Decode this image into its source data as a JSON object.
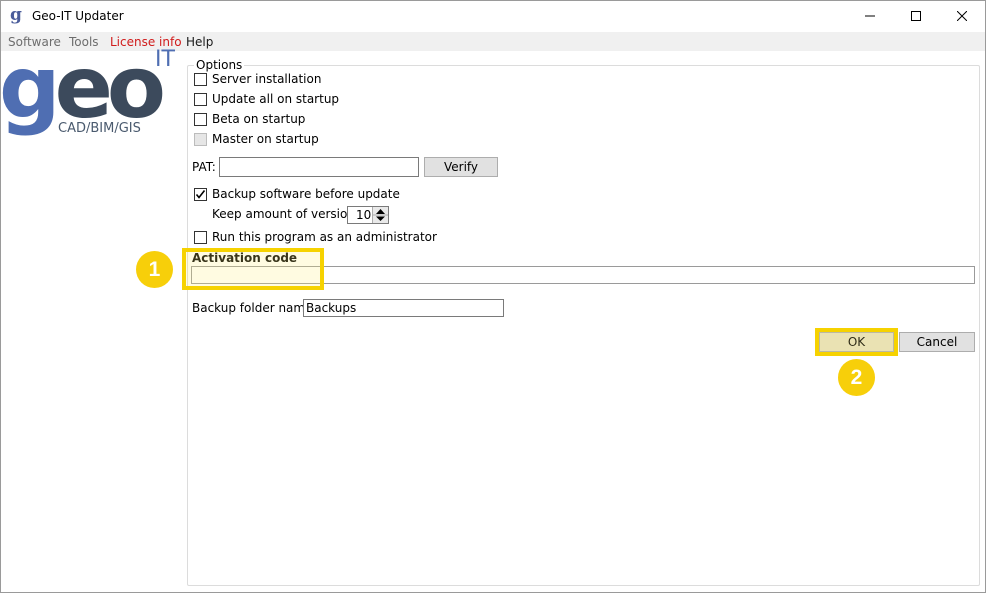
{
  "window": {
    "title": "Geo-IT Updater",
    "app_icon_letter": "g"
  },
  "menu": {
    "software": "Software",
    "tools": "Tools",
    "license_info": "License info",
    "help": "Help"
  },
  "logo": {
    "geo_g": "g",
    "geo_eo": "eo",
    "it": "IT",
    "subtitle": "CAD/BIM/GIS"
  },
  "options": {
    "legend": "Options",
    "server_installation": {
      "label": "Server installation",
      "checked": false
    },
    "update_all_on_startup": {
      "label": "Update all on startup",
      "checked": false
    },
    "beta_on_startup": {
      "label": "Beta on startup",
      "checked": false
    },
    "master_on_startup": {
      "label": "Master on startup",
      "checked": false,
      "disabled": true
    },
    "pat_label": "PAT:",
    "pat_value": "",
    "verify_label": "Verify",
    "backup_before_update": {
      "label": "Backup software before update",
      "checked": true
    },
    "keep_versions_label": "Keep amount of versions:",
    "keep_versions_value": "10",
    "run_as_admin": {
      "label": "Run this program as an administrator",
      "checked": false
    },
    "activation_code_label": "Activation code",
    "activation_code_value": "",
    "backup_folder_label": "Backup folder name:",
    "backup_folder_value": "Backups",
    "ok_label": "OK",
    "cancel_label": "Cancel"
  },
  "callouts": {
    "first": "1",
    "second": "2"
  },
  "colors": {
    "highlight": "#f6d200",
    "callout": "#f7cf0a",
    "license_info": "#d11b1b",
    "logo_blue": "#4f6eb2",
    "logo_dark": "#3c4a5c"
  }
}
